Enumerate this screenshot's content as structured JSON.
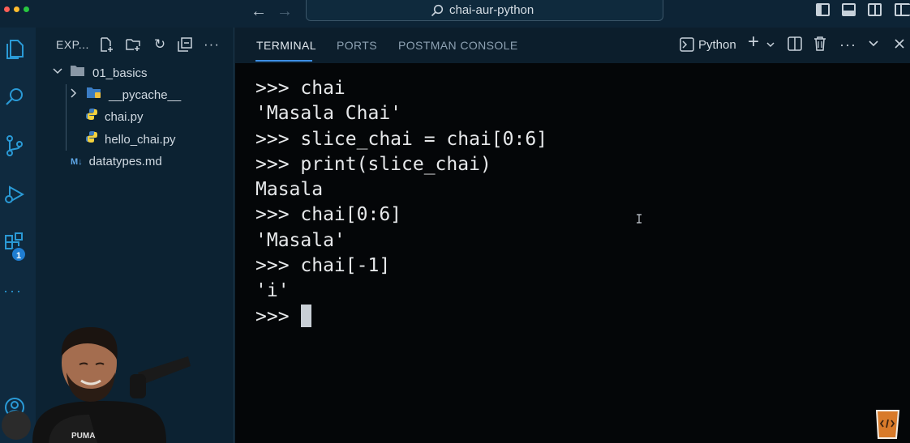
{
  "window": {
    "title": "chai-aur-python"
  },
  "titlebar_icons": [
    "arrow-left-icon",
    "arrow-right-icon",
    "search-icon",
    "toggle-sidebar-icon",
    "toggle-panel-icon",
    "toggle-secondary-sidebar-icon",
    "customize-layout-icon"
  ],
  "activity_bar": {
    "items": [
      "explorer-icon",
      "search-icon",
      "source-control-icon",
      "run-debug-icon",
      "extensions-icon",
      "more-icon",
      "account-icon"
    ],
    "extensions_badge": "1"
  },
  "explorer": {
    "title": "EXP...",
    "actions": [
      "new-file-icon",
      "new-folder-icon",
      "refresh-icon",
      "collapse-icon",
      "more-icon"
    ],
    "tree": [
      {
        "label": "01_basics",
        "type": "folder",
        "expanded": true
      },
      {
        "label": "__pycache__",
        "type": "folder",
        "expanded": false
      },
      {
        "label": "chai.py",
        "type": "python-file"
      },
      {
        "label": "hello_chai.py",
        "type": "python-file"
      },
      {
        "label": "datatypes.md",
        "type": "markdown-file"
      }
    ]
  },
  "panel": {
    "tabs": [
      "TERMINAL",
      "PORTS",
      "POSTMAN CONSOLE"
    ],
    "active_tab": "TERMINAL",
    "terminal_name": "Python",
    "actions": [
      "new-terminal-icon",
      "dropdown-icon",
      "split-terminal-icon",
      "trash-icon",
      "more-icon",
      "chevron-down-icon",
      "close-icon"
    ]
  },
  "terminal": {
    "prompt": ">>>",
    "lines": [
      ">>> chai",
      "'Masala Chai'",
      ">>> slice_chai = chai[0:6]",
      ">>> print(slice_chai)",
      "Masala",
      ">>> chai[0:6]",
      "'Masala'",
      ">>> chai[-1]",
      "'i'"
    ]
  },
  "colors": {
    "accent": "#3d8fe6",
    "titlebar": "#0d2436",
    "terminal_bg": "#040608",
    "sidebar_bg": "#0c2232"
  }
}
